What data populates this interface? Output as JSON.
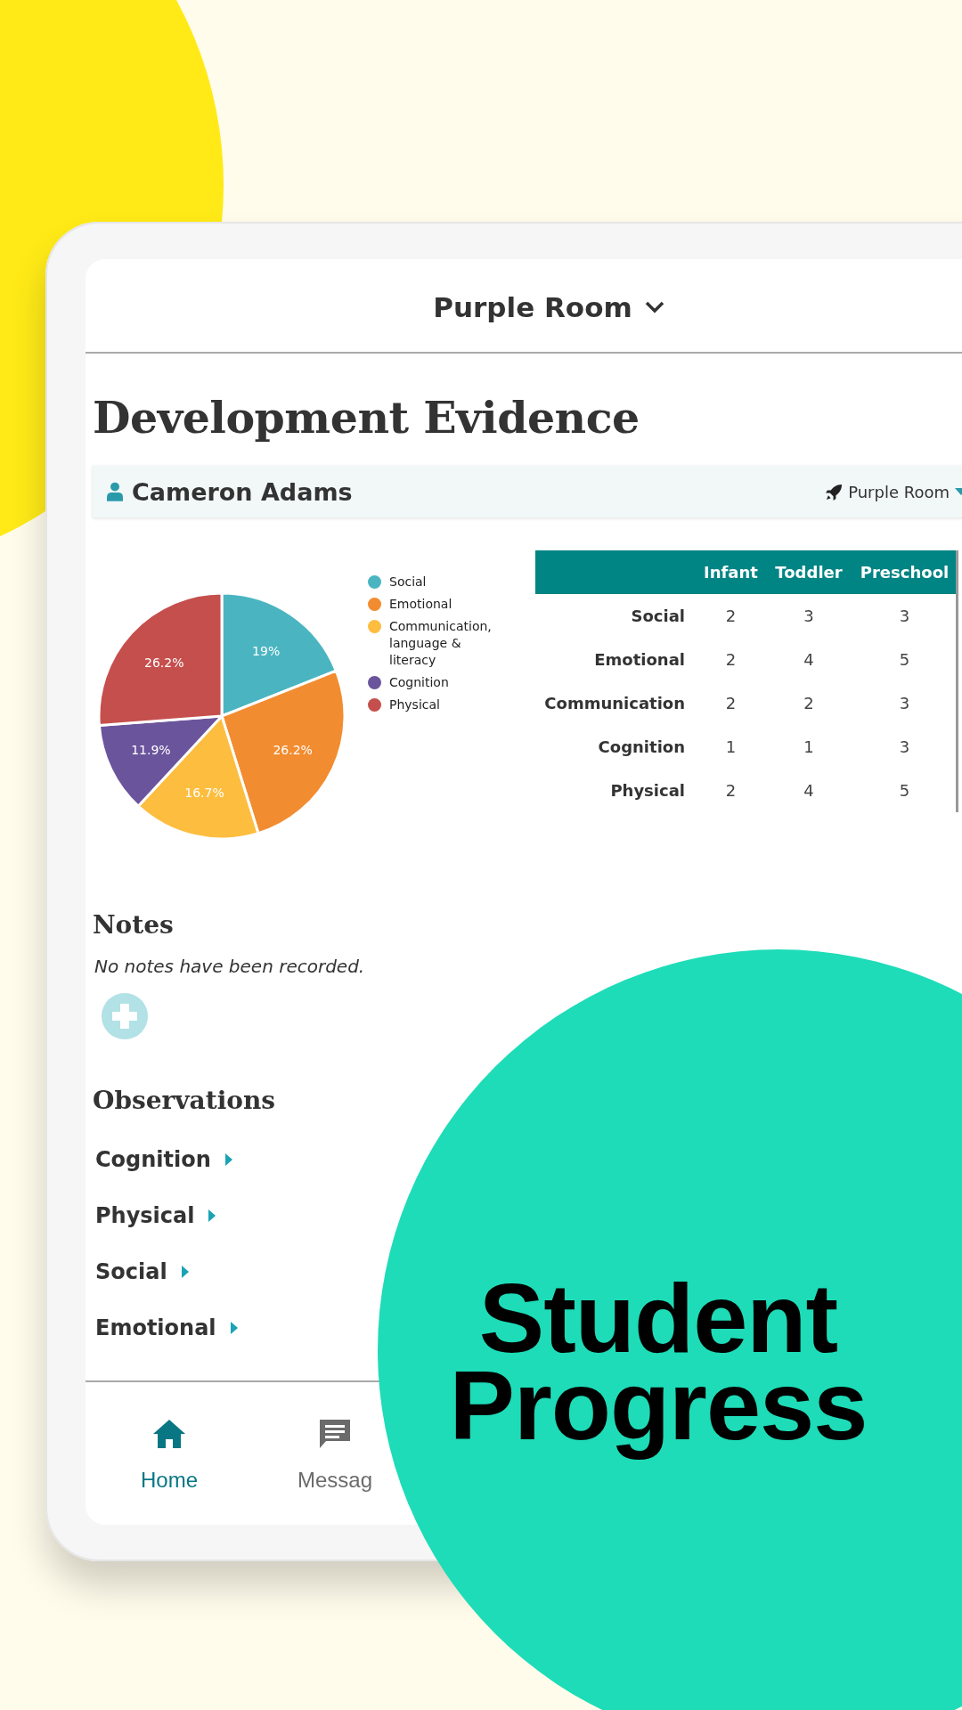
{
  "header": {
    "title": "Purple Room"
  },
  "page_title": "Development Evidence",
  "student_bar": {
    "name": "Cameron Adams",
    "room": "Purple Room"
  },
  "chart_data": {
    "type": "pie",
    "categories": [
      "Social",
      "Emotional",
      "Communication, language & literacy",
      "Cognition",
      "Physical"
    ],
    "values": [
      19,
      26.2,
      16.7,
      11.9,
      26.2
    ],
    "colors": [
      "#4ab5c1",
      "#f28c30",
      "#fdbd3f",
      "#6a549c",
      "#c54f4d"
    ],
    "value_labels": [
      "19%",
      "26.2%",
      "16.7%",
      "11.9%",
      "26.2%"
    ]
  },
  "table": {
    "columns": [
      "Infant",
      "Toddler",
      "Preschool"
    ],
    "rows": [
      {
        "label": "Social",
        "cells": [
          "2",
          "3",
          "3"
        ]
      },
      {
        "label": "Emotional",
        "cells": [
          "2",
          "4",
          "5"
        ]
      },
      {
        "label": "Communication",
        "cells": [
          "2",
          "2",
          "3"
        ]
      },
      {
        "label": "Cognition",
        "cells": [
          "1",
          "1",
          "3"
        ]
      },
      {
        "label": "Physical",
        "cells": [
          "2",
          "4",
          "5"
        ]
      }
    ]
  },
  "notes": {
    "title": "Notes",
    "empty_text": "No notes have been recorded."
  },
  "observations": {
    "title": "Observations",
    "items": [
      {
        "label": "Cognition",
        "expanded": false
      },
      {
        "label": "Physical",
        "expanded": false
      },
      {
        "label": "Social",
        "expanded": false
      },
      {
        "label": "Emotional",
        "expanded": false
      }
    ]
  },
  "nav": [
    {
      "label": "Home",
      "kind": "home",
      "selected": true
    },
    {
      "label": "Messag",
      "kind": "message",
      "selected": false
    }
  ],
  "promo": {
    "headline": [
      "Student",
      "Progress"
    ]
  }
}
